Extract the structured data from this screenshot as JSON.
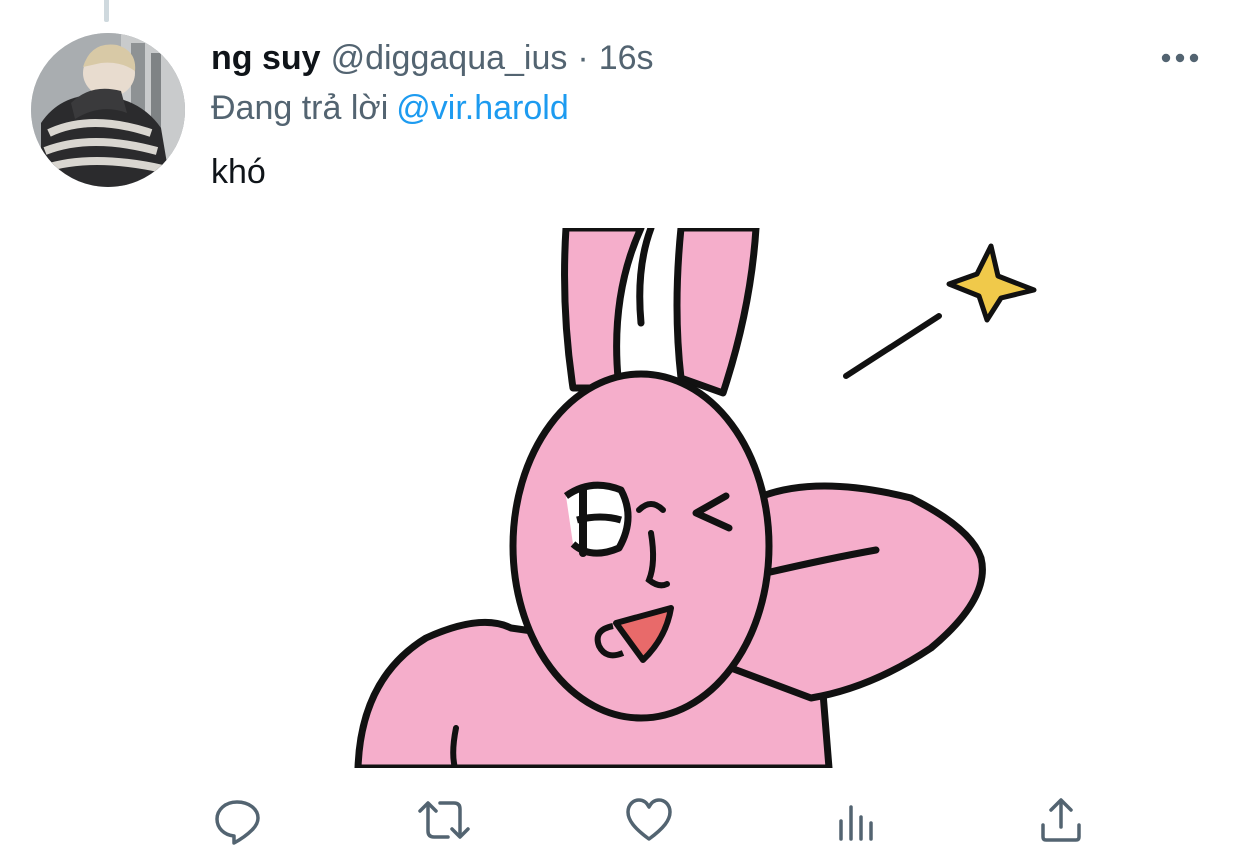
{
  "tweet": {
    "display_name": "ng suy",
    "handle": "@diggaqua_ius",
    "separator": "·",
    "time": "16s",
    "reply_prefix": "Đang trả lời",
    "reply_to": "@vir.harold",
    "text": "khó"
  },
  "icons": {
    "more": "more-horizontal-icon",
    "reply": "reply-bubble-icon",
    "retweet": "retweet-icon",
    "like": "heart-icon",
    "views": "bar-chart-icon",
    "share": "share-upload-icon"
  },
  "colors": {
    "text_primary": "#0f1419",
    "text_secondary": "#536471",
    "link": "#1d9bf0",
    "rabbit_pink": "#f5aecb",
    "star_yellow": "#f0c94a"
  }
}
